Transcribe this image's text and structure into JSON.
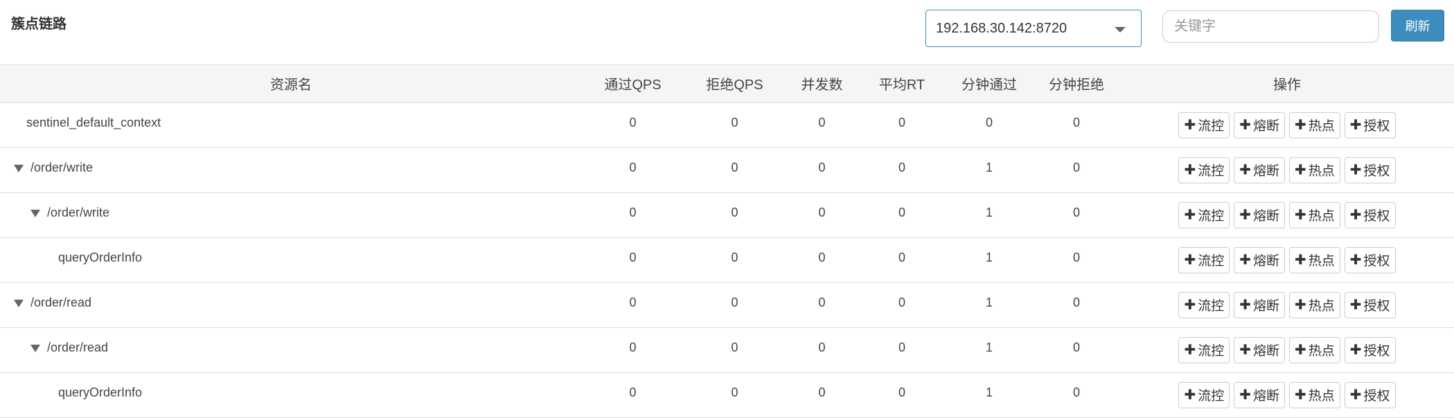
{
  "header": {
    "title": "簇点链路",
    "machine_select": "192.168.30.142:8720",
    "search_placeholder": "关键字",
    "refresh_label": "刷新"
  },
  "table": {
    "columns": [
      "资源名",
      "通过QPS",
      "拒绝QPS",
      "并发数",
      "平均RT",
      "分钟通过",
      "分钟拒绝",
      "操作"
    ],
    "action_labels": [
      "流控",
      "熔断",
      "热点",
      "授权"
    ],
    "rows": [
      {
        "name": "sentinel_default_context",
        "pass_qps": "0",
        "block_qps": "0",
        "concurrency": "0",
        "avg_rt": "0",
        "min_pass": "0",
        "min_block": "0"
      },
      {
        "name": "/order/write",
        "pass_qps": "0",
        "block_qps": "0",
        "concurrency": "0",
        "avg_rt": "0",
        "min_pass": "1",
        "min_block": "0"
      },
      {
        "name": "/order/write",
        "pass_qps": "0",
        "block_qps": "0",
        "concurrency": "0",
        "avg_rt": "0",
        "min_pass": "1",
        "min_block": "0"
      },
      {
        "name": "queryOrderInfo",
        "pass_qps": "0",
        "block_qps": "0",
        "concurrency": "0",
        "avg_rt": "0",
        "min_pass": "1",
        "min_block": "0"
      },
      {
        "name": "/order/read",
        "pass_qps": "0",
        "block_qps": "0",
        "concurrency": "0",
        "avg_rt": "0",
        "min_pass": "1",
        "min_block": "0"
      },
      {
        "name": "/order/read",
        "pass_qps": "0",
        "block_qps": "0",
        "concurrency": "0",
        "avg_rt": "0",
        "min_pass": "1",
        "min_block": "0"
      },
      {
        "name": "queryOrderInfo",
        "pass_qps": "0",
        "block_qps": "0",
        "concurrency": "0",
        "avg_rt": "0",
        "min_pass": "1",
        "min_block": "0"
      }
    ]
  },
  "icons": {
    "expand": "caret-down-icon",
    "add": "plus-icon",
    "select": "chevron-down-icon"
  },
  "colors": {
    "primary": "#3c8dbc",
    "header_bg": "#f5f5f5"
  }
}
